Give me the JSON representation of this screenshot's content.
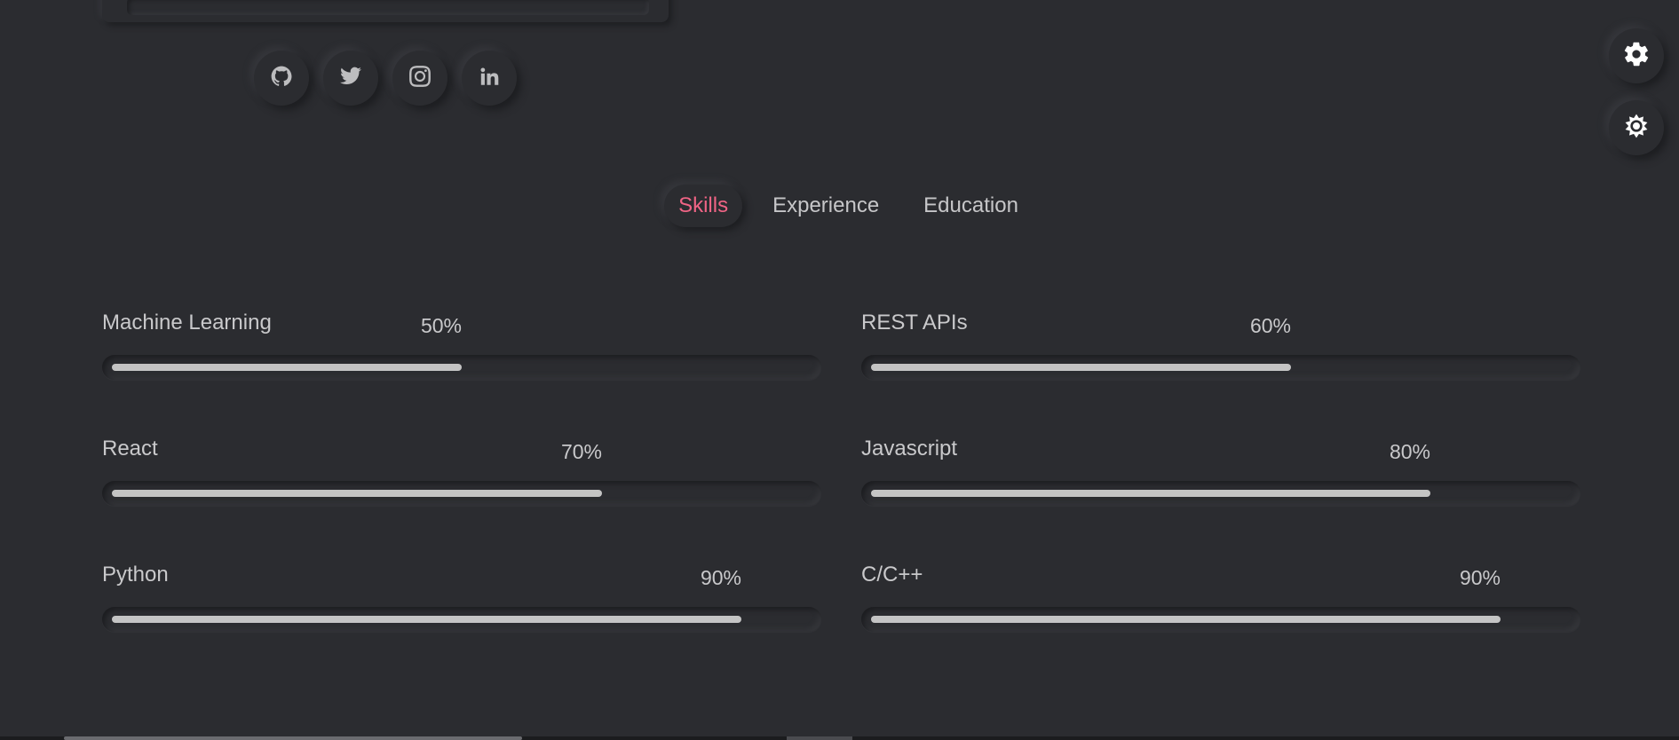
{
  "colors": {
    "background": "#2b2c30",
    "accent": "#f06485",
    "text": "#c6c6c8",
    "bar_fill": "#c4c4c4"
  },
  "social": [
    {
      "icon": "github-icon",
      "name": "github-link"
    },
    {
      "icon": "twitter-icon",
      "name": "twitter-link"
    },
    {
      "icon": "instagram-icon",
      "name": "instagram-link"
    },
    {
      "icon": "linkedin-icon",
      "name": "linkedin-link"
    }
  ],
  "floating": {
    "settings_icon": "gear-icon",
    "theme_icon": "sun-icon"
  },
  "tabs": [
    {
      "label": "Skills",
      "active": true
    },
    {
      "label": "Experience",
      "active": false
    },
    {
      "label": "Education",
      "active": false
    }
  ],
  "skills": [
    {
      "name": "Machine Learning",
      "percent_label": "50%",
      "value": 50
    },
    {
      "name": "REST APIs",
      "percent_label": "60%",
      "value": 60
    },
    {
      "name": "React",
      "percent_label": "70%",
      "value": 70
    },
    {
      "name": "Javascript",
      "percent_label": "80%",
      "value": 80
    },
    {
      "name": "Python",
      "percent_label": "90%",
      "value": 90
    },
    {
      "name": "C/C++",
      "percent_label": "90%",
      "value": 90
    }
  ]
}
